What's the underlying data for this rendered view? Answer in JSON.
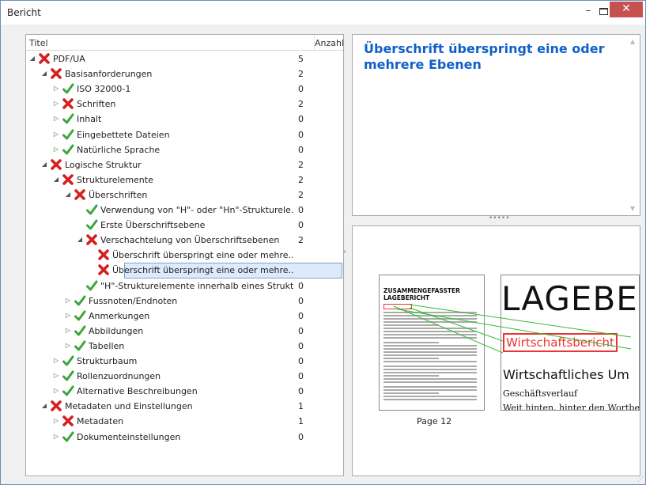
{
  "window": {
    "title": "Bericht"
  },
  "titlebar": {
    "minimize": "–",
    "close": "✕"
  },
  "tree": {
    "col_title": "Titel",
    "col_count": "Anzahl",
    "rows": [
      {
        "label": "PDF/UA",
        "count": "5",
        "status": "fail",
        "level": 0,
        "toggle": "expanded"
      },
      {
        "label": "Basisanforderungen",
        "count": "2",
        "status": "fail",
        "level": 1,
        "toggle": "expanded"
      },
      {
        "label": "ISO 32000-1",
        "count": "0",
        "status": "pass",
        "level": 2,
        "toggle": "collapsed"
      },
      {
        "label": "Schriften",
        "count": "2",
        "status": "fail",
        "level": 2,
        "toggle": "collapsed"
      },
      {
        "label": "Inhalt",
        "count": "0",
        "status": "pass",
        "level": 2,
        "toggle": "collapsed"
      },
      {
        "label": "Eingebettete Dateien",
        "count": "0",
        "status": "pass",
        "level": 2,
        "toggle": "collapsed"
      },
      {
        "label": "Natürliche Sprache",
        "count": "0",
        "status": "pass",
        "level": 2,
        "toggle": "collapsed"
      },
      {
        "label": "Logische Struktur",
        "count": "2",
        "status": "fail",
        "level": 1,
        "toggle": "expanded"
      },
      {
        "label": "Strukturelemente",
        "count": "2",
        "status": "fail",
        "level": 2,
        "toggle": "expanded"
      },
      {
        "label": "Überschriften",
        "count": "2",
        "status": "fail",
        "level": 3,
        "toggle": "expanded"
      },
      {
        "label": "Verwendung von \"H\"- oder \"Hn\"-Strukturele...",
        "count": "0",
        "status": "pass",
        "level": 4,
        "toggle": "none"
      },
      {
        "label": "Erste Überschriftsebene",
        "count": "0",
        "status": "pass",
        "level": 4,
        "toggle": "none"
      },
      {
        "label": "Verschachtelung von Überschriftsebenen",
        "count": "2",
        "status": "fail",
        "level": 4,
        "toggle": "expanded"
      },
      {
        "label": "Überschrift überspringt eine oder mehre...",
        "count": "",
        "status": "fail",
        "level": 5,
        "toggle": "none"
      },
      {
        "label": "Überschrift überspringt eine oder mehre...",
        "count": "",
        "status": "fail",
        "level": 5,
        "toggle": "none",
        "selected": true
      },
      {
        "label": "\"H\"-Strukturelemente innerhalb eines Strukt...",
        "count": "0",
        "status": "pass",
        "level": 4,
        "toggle": "none"
      },
      {
        "label": "Fussnoten/Endnoten",
        "count": "0",
        "status": "pass",
        "level": 3,
        "toggle": "collapsed"
      },
      {
        "label": "Anmerkungen",
        "count": "0",
        "status": "pass",
        "level": 3,
        "toggle": "collapsed"
      },
      {
        "label": "Abbildungen",
        "count": "0",
        "status": "pass",
        "level": 3,
        "toggle": "collapsed"
      },
      {
        "label": "Tabellen",
        "count": "0",
        "status": "pass",
        "level": 3,
        "toggle": "collapsed"
      },
      {
        "label": "Strukturbaum",
        "count": "0",
        "status": "pass",
        "level": 2,
        "toggle": "collapsed"
      },
      {
        "label": "Rollenzuordnungen",
        "count": "0",
        "status": "pass",
        "level": 2,
        "toggle": "collapsed"
      },
      {
        "label": "Alternative Beschreibungen",
        "count": "0",
        "status": "pass",
        "level": 2,
        "toggle": "collapsed"
      },
      {
        "label": "Metadaten und Einstellungen",
        "count": "1",
        "status": "fail",
        "level": 1,
        "toggle": "expanded"
      },
      {
        "label": "Metadaten",
        "count": "1",
        "status": "fail",
        "level": 2,
        "toggle": "collapsed"
      },
      {
        "label": "Dokumenteinstellungen",
        "count": "0",
        "status": "pass",
        "level": 2,
        "toggle": "collapsed"
      }
    ]
  },
  "detail": {
    "message": "Überschrift überspringt eine oder mehrere Ebenen"
  },
  "preview": {
    "page_label": "Page 12",
    "thumb_title": "ZUSAMMENGEFASSTER LAGEBERICHT",
    "zoom_heading": "LAGEBE",
    "zoom_highlight": "Wirtschaftsbericht",
    "zoom_subheading": "Wirtschaftliches Um",
    "zoom_text1": "Geschäftsverlauf",
    "zoom_text2": "Weit hinten, hinter den Wortber"
  },
  "colors": {
    "fail": "#d42020",
    "pass": "#3aa63a",
    "accent": "#1060c8",
    "highlight": "#ee3333",
    "link_line": "#33bb33"
  },
  "icons": {
    "fail": "red-x-icon",
    "pass": "green-check-icon"
  }
}
